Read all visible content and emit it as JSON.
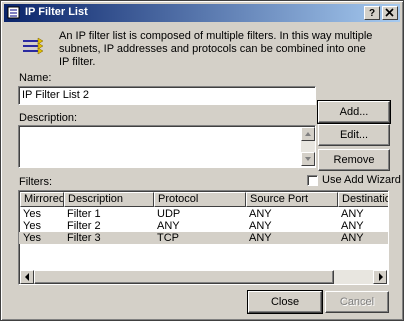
{
  "window": {
    "title": "IP Filter List",
    "help_button": "?",
    "close_button": "X"
  },
  "intro": {
    "text": "An IP filter list is composed of multiple filters. In this way multiple subnets, IP addresses and protocols can be combined into one IP filter."
  },
  "name_field": {
    "label": "Name:",
    "value": "IP Filter List 2"
  },
  "description_field": {
    "label": "Description:",
    "value": ""
  },
  "buttons": {
    "add": "Add...",
    "edit": "Edit...",
    "remove": "Remove",
    "close": "Close",
    "cancel": "Cancel"
  },
  "wizard_checkbox": {
    "label": "Use Add Wizard",
    "checked": false
  },
  "filters": {
    "label": "Filters:",
    "columns": [
      "Mirrored",
      "Description",
      "Protocol",
      "Source Port",
      "Destination"
    ],
    "rows": [
      {
        "mirrored": "Yes",
        "description": "Filter 1",
        "protocol": "UDP",
        "source_port": "ANY",
        "destination": "ANY",
        "selected": false
      },
      {
        "mirrored": "Yes",
        "description": "Filter 2",
        "protocol": "ANY",
        "source_port": "ANY",
        "destination": "ANY",
        "selected": false
      },
      {
        "mirrored": "Yes",
        "description": "Filter 3",
        "protocol": "TCP",
        "source_port": "ANY",
        "destination": "ANY",
        "selected": true
      }
    ]
  },
  "colors": {
    "title_start": "#0a246a",
    "title_end": "#a6caf0",
    "face": "#d4d0c8"
  }
}
